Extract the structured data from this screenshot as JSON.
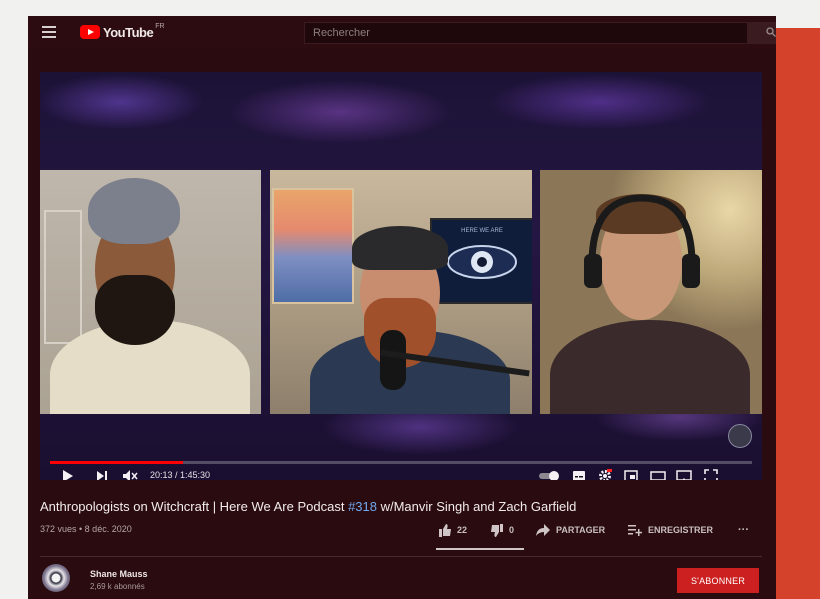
{
  "masthead": {
    "logo_text": "YouTube",
    "country_code": "FR",
    "search_placeholder": "Rechercher",
    "icons": [
      "menu-icon",
      "search-icon"
    ]
  },
  "video": {
    "poster_text": "HERE WE ARE",
    "time_display": "20:13 / 1:45:30",
    "progress_fraction": 0.19,
    "title_main": "Anthropologists on Witchcraft | Here We Are Podcast ",
    "title_hashtag": "#318",
    "title_rest": " w/Manvir Singh and Zach Garfield",
    "views_date": "372 vues • 8 déc. 2020",
    "likes": "22",
    "dislikes": "0",
    "like_ratio": 1.0,
    "share_label": "PARTAGER",
    "save_label": "ENREGISTRER",
    "more_label": "···"
  },
  "channel": {
    "name": "Shane Mauss",
    "subscribers": "2,69 k abonnés",
    "subscribe_label": "S'ABONNER"
  },
  "colors": {
    "accent": "#ff0000",
    "subscribe": "#cc1f1f",
    "orange_panel": "#d4422c",
    "hashtag": "#6fa8f0"
  }
}
